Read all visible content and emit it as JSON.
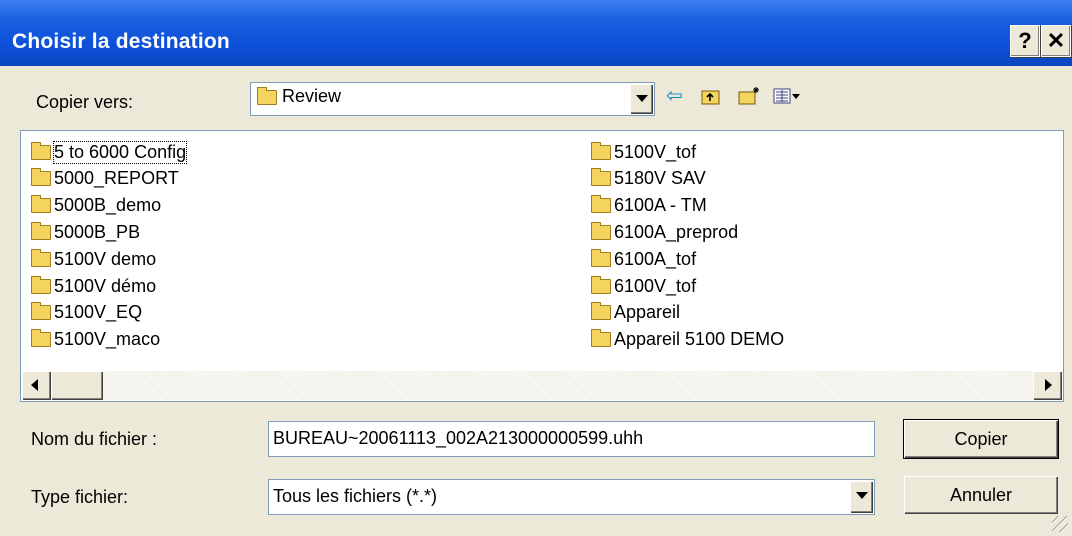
{
  "window": {
    "title": "Choisir la destination",
    "help_label": "?",
    "close_label": "✕"
  },
  "location": {
    "label": "Copier vers:",
    "value": "Review"
  },
  "toolbar": {
    "back_icon": "⇦",
    "up_icon": "up-folder-icon",
    "new_folder_icon": "new-folder-icon",
    "view_menu_icon": "view-menu-icon"
  },
  "files": {
    "left": [
      "5 to 6000 Config",
      "5000_REPORT",
      "5000B_demo",
      "5000B_PB",
      "5100V demo",
      "5100V démo",
      "5100V_EQ",
      "5100V_maco"
    ],
    "right": [
      "5100V_tof",
      "5180V SAV",
      "6100A - TM",
      "6100A_preprod",
      "6100A_tof",
      "6100V_tof",
      "Appareil",
      "Appareil 5100 DEMO"
    ]
  },
  "filename": {
    "label": "Nom du fichier :",
    "value": "BUREAU~20061113_002A213000000599.uhh"
  },
  "filetype": {
    "label": "Type fichier:",
    "value": "Tous les fichiers (*.*)"
  },
  "buttons": {
    "copy": "Copier",
    "cancel": "Annuler"
  },
  "colors": {
    "titlebar": "#0c50d8",
    "dialog_bg": "#ece9d8",
    "folder": "#f4d35e"
  }
}
